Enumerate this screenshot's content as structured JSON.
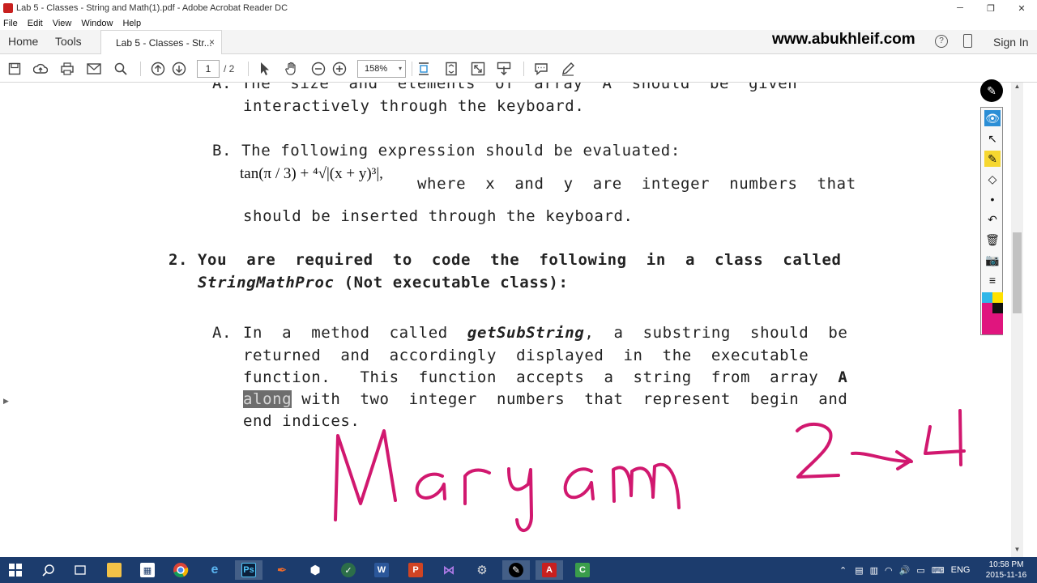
{
  "window": {
    "title": "Lab 5 - Classes - String and Math(1).pdf - Adobe Acrobat Reader DC",
    "minimize": "─",
    "maximize": "❐",
    "close": "✕"
  },
  "menu": [
    "File",
    "Edit",
    "View",
    "Window",
    "Help"
  ],
  "tabs": {
    "home": "Home",
    "tools": "Tools",
    "document": "Lab 5 - Classes - Str...",
    "close": "×",
    "watermark": "www.abukhleif.com",
    "help": "?",
    "signin": "Sign In"
  },
  "toolbar": {
    "page_current": "1",
    "page_total": "/ 2",
    "zoom": "158%",
    "zoom_caret": "▾"
  },
  "document": {
    "line_a_top_1": "A. The  size  and  elements  of  array  A  should  be  given",
    "line_a_top_2": "interactively through the keyboard.",
    "line_b_1": "B. The following expression should be evaluated:",
    "formula": "tan(π / 3) + ⁴√|(x + y)³|,",
    "line_b_2": "where  x  and  y  are  integer  numbers  that",
    "line_b_3": "should be inserted through the keyboard.",
    "item2_num": "2.",
    "item2_line1": "You  are  required  to  code  the  following  in  a  class  called",
    "item2_class": "StringMathProc",
    "item2_rest": " (Not executable class):",
    "a2_label": "A.",
    "a2_l1_pre": "In  a  method  called  ",
    "a2_l1_method": "getSubString",
    "a2_l1_post": ",  a  substring  should  be",
    "a2_l2": "returned  and  accordingly  displayed  in  the  executable",
    "a2_l3_pre": "function.   This  function  accepts  a  string  from  array  ",
    "a2_l3_bold": "A",
    "a2_l4_hl": "along",
    "a2_l4_rest": " with  two  integer  numbers  that  represent  begin  and",
    "a2_l5": "end indices."
  },
  "taskbar": {
    "lang": "ENG",
    "time": "10:58 PM",
    "date": "2015-11-16"
  },
  "colors": {
    "ink": "#d1186f",
    "taskbar": "#1c3c6d",
    "tool_active": "#2b8ed6"
  }
}
